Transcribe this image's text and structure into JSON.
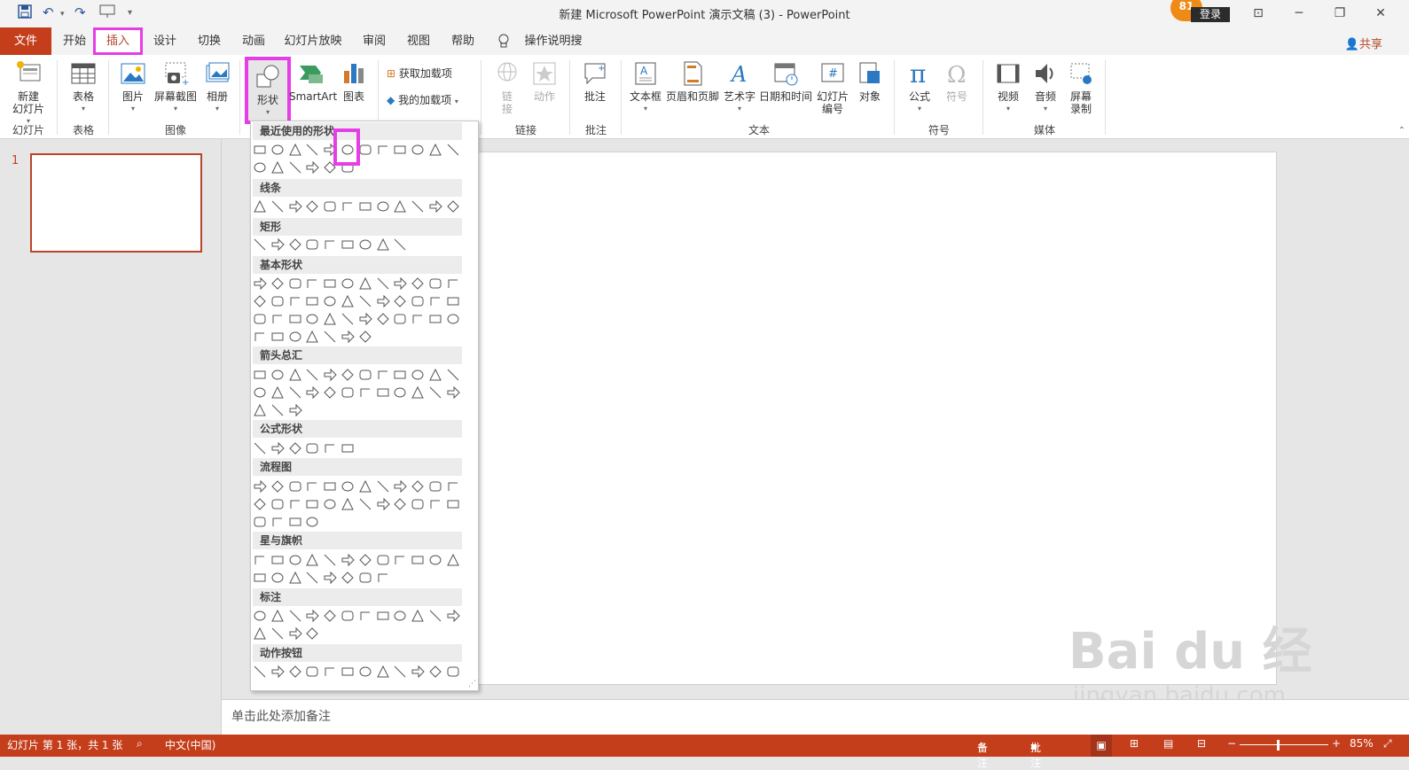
{
  "window": {
    "title": "新建 Microsoft PowerPoint 演示文稿 (3)  -  PowerPoint",
    "badge_count": "81",
    "login_label": "登录",
    "share_label": "共享"
  },
  "tabs": {
    "file": "文件",
    "items": [
      "开始",
      "插入",
      "设计",
      "切换",
      "动画",
      "幻灯片放映",
      "审阅",
      "视图",
      "帮助"
    ],
    "tell_me": "操作说明搜索"
  },
  "ribbon": {
    "new_slide": "新建\n幻灯片",
    "table": "表格",
    "picture": "图片",
    "screenshot": "屏幕截图",
    "album": "相册",
    "shape": "形状",
    "smartart": "SmartArt",
    "chart": "图表",
    "get_addins": "获取加载项",
    "my_addins": "我的加载项",
    "link": "链\n接",
    "action": "动作",
    "comment": "批注",
    "textbox": "文本框",
    "header_footer": "页眉和页脚",
    "wordart": "艺术字",
    "datetime": "日期和时间",
    "slide_number": "幻灯片\n编号",
    "object": "对象",
    "equation": "公式",
    "symbol": "符号",
    "video": "视频",
    "audio": "音频",
    "screen_record": "屏幕\n录制",
    "groups": {
      "slides": "幻灯片",
      "tables": "表格",
      "images": "图像",
      "links": "链接",
      "comments": "批注",
      "text": "文本",
      "symbols": "符号",
      "media": "媒体"
    }
  },
  "gallery": {
    "categories": [
      "最近使用的形状",
      "线条",
      "矩形",
      "基本形状",
      "箭头总汇",
      "公式形状",
      "流程图",
      "星与旗帜",
      "标注",
      "动作按钮"
    ]
  },
  "slides_pane": {
    "slide_number": "1"
  },
  "notes": {
    "placeholder": "单击此处添加备注"
  },
  "status": {
    "slide_info": "幻灯片 第 1 张，共 1 张",
    "language": "中文(中国)",
    "notes_btn": "备注",
    "comments_btn": "批注",
    "zoom": "85%"
  },
  "watermark": {
    "main": "Bai du 经验",
    "sub": "jingyan.baidu.com"
  },
  "colors": {
    "accent": "#c43e1c",
    "highlight": "#e63ee6",
    "ribbon_bg": "#ffffff"
  }
}
